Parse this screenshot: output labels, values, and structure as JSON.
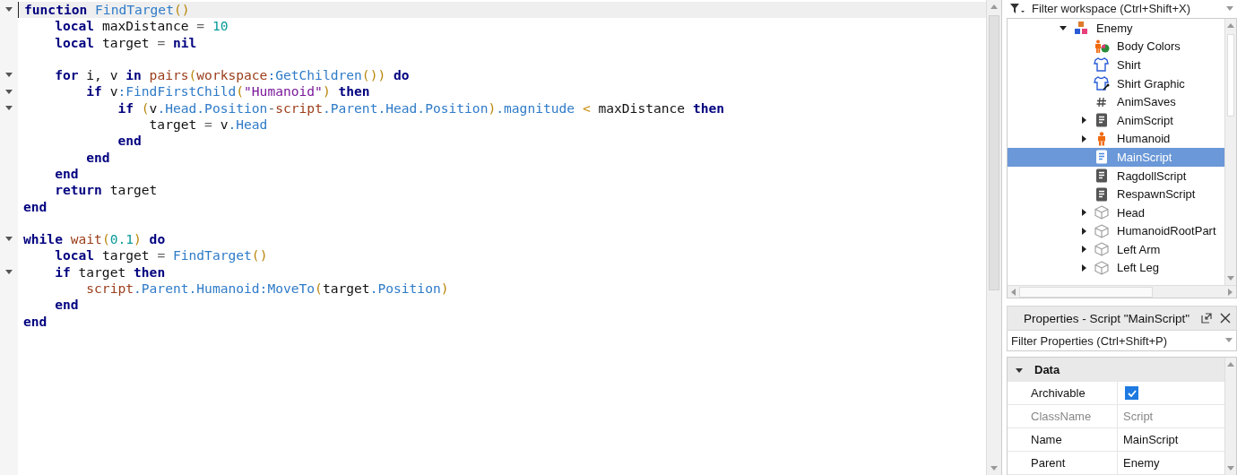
{
  "editor": {
    "lines": [
      {
        "foldable": true,
        "current": true,
        "tokens": [
          {
            "kind": "kw",
            "text": "function "
          },
          {
            "kind": "fn",
            "text": "FindTarget"
          },
          {
            "kind": "p",
            "text": "()"
          }
        ]
      },
      {
        "foldable": false,
        "current": false,
        "tokens": [
          {
            "kind": "kw",
            "text": "    local "
          },
          {
            "kind": "id",
            "text": "maxDistance "
          },
          {
            "kind": "op",
            "text": "= "
          },
          {
            "kind": "num",
            "text": "10"
          }
        ]
      },
      {
        "foldable": false,
        "current": false,
        "tokens": [
          {
            "kind": "kw",
            "text": "    local "
          },
          {
            "kind": "id",
            "text": "target "
          },
          {
            "kind": "op",
            "text": "= "
          },
          {
            "kind": "kw",
            "text": "nil"
          }
        ]
      },
      {
        "foldable": false,
        "current": false
      },
      {
        "foldable": true,
        "current": false,
        "tokens": [
          {
            "kind": "kw",
            "text": "    for "
          },
          {
            "kind": "id",
            "text": "i, v "
          },
          {
            "kind": "kw",
            "text": "in "
          },
          {
            "kind": "bi",
            "text": "pairs"
          },
          {
            "kind": "p",
            "text": "("
          },
          {
            "kind": "bi",
            "text": "workspace"
          },
          {
            "kind": "fn",
            "text": ":GetChildren"
          },
          {
            "kind": "p",
            "text": "())"
          },
          {
            "kind": "kw",
            "text": " do"
          }
        ]
      },
      {
        "foldable": true,
        "current": false,
        "tokens": [
          {
            "kind": "kw",
            "text": "        if "
          },
          {
            "kind": "id",
            "text": "v"
          },
          {
            "kind": "fn",
            "text": ":FindFirstChild"
          },
          {
            "kind": "p",
            "text": "("
          },
          {
            "kind": "str",
            "text": "\"Humanoid\""
          },
          {
            "kind": "p",
            "text": ") "
          },
          {
            "kind": "kw",
            "text": "then"
          }
        ]
      },
      {
        "foldable": true,
        "current": false,
        "tokens": [
          {
            "kind": "kw",
            "text": "            if "
          },
          {
            "kind": "p",
            "text": "("
          },
          {
            "kind": "id",
            "text": "v"
          },
          {
            "kind": "fn",
            "text": ".Head.Position"
          },
          {
            "kind": "op",
            "text": "-"
          },
          {
            "kind": "bi",
            "text": "script"
          },
          {
            "kind": "fn",
            "text": ".Parent.Head.Position"
          },
          {
            "kind": "p",
            "text": ")"
          },
          {
            "kind": "fn",
            "text": ".magnitude "
          },
          {
            "kind": "lt",
            "text": "< "
          },
          {
            "kind": "id",
            "text": "maxDistance "
          },
          {
            "kind": "kw",
            "text": "then"
          }
        ]
      },
      {
        "foldable": false,
        "current": false,
        "tokens": [
          {
            "kind": "id",
            "text": "                target "
          },
          {
            "kind": "op",
            "text": "= "
          },
          {
            "kind": "id",
            "text": "v"
          },
          {
            "kind": "fn",
            "text": ".Head"
          }
        ]
      },
      {
        "foldable": false,
        "current": false,
        "tokens": [
          {
            "kind": "kw",
            "text": "            end"
          }
        ]
      },
      {
        "foldable": false,
        "current": false,
        "tokens": [
          {
            "kind": "kw",
            "text": "        end"
          }
        ]
      },
      {
        "foldable": false,
        "current": false,
        "tokens": [
          {
            "kind": "kw",
            "text": "    end"
          }
        ]
      },
      {
        "foldable": false,
        "current": false,
        "tokens": [
          {
            "kind": "kw",
            "text": "    return "
          },
          {
            "kind": "id",
            "text": "target"
          }
        ]
      },
      {
        "foldable": false,
        "current": false,
        "tokens": [
          {
            "kind": "kw",
            "text": "end"
          }
        ]
      },
      {
        "foldable": false,
        "current": false
      },
      {
        "foldable": true,
        "current": false,
        "tokens": [
          {
            "kind": "kw",
            "text": "while "
          },
          {
            "kind": "bi",
            "text": "wait"
          },
          {
            "kind": "p",
            "text": "("
          },
          {
            "kind": "num",
            "text": "0.1"
          },
          {
            "kind": "p",
            "text": ") "
          },
          {
            "kind": "kw",
            "text": "do"
          }
        ]
      },
      {
        "foldable": false,
        "current": false,
        "tokens": [
          {
            "kind": "kw",
            "text": "    local "
          },
          {
            "kind": "id",
            "text": "target "
          },
          {
            "kind": "op",
            "text": "= "
          },
          {
            "kind": "fn",
            "text": "FindTarget"
          },
          {
            "kind": "p",
            "text": "()"
          }
        ]
      },
      {
        "foldable": true,
        "current": false,
        "tokens": [
          {
            "kind": "kw",
            "text": "    if "
          },
          {
            "kind": "id",
            "text": "target "
          },
          {
            "kind": "kw",
            "text": "then"
          }
        ]
      },
      {
        "foldable": false,
        "current": false,
        "tokens": [
          {
            "kind": "bi",
            "text": "        script"
          },
          {
            "kind": "fn",
            "text": ".Parent.Humanoid:MoveTo"
          },
          {
            "kind": "p",
            "text": "("
          },
          {
            "kind": "id",
            "text": "target"
          },
          {
            "kind": "fn",
            "text": ".Position"
          },
          {
            "kind": "p",
            "text": ")"
          }
        ]
      },
      {
        "foldable": false,
        "current": false,
        "tokens": [
          {
            "kind": "kw",
            "text": "    end"
          }
        ]
      },
      {
        "foldable": false,
        "current": false,
        "tokens": [
          {
            "kind": "kw",
            "text": "end"
          }
        ]
      }
    ]
  },
  "explorer": {
    "filter": {
      "placeholder": "Filter workspace (Ctrl+Shift+X)"
    },
    "items": [
      {
        "name": "Enemy",
        "kind": "model",
        "expandable": true,
        "expanded": true,
        "selected": false,
        "children": [
          {
            "name": "Body Colors",
            "kind": "body-colors",
            "expandable": false,
            "selected": false
          },
          {
            "name": "Shirt",
            "kind": "shirt",
            "expandable": false,
            "selected": false
          },
          {
            "name": "Shirt Graphic",
            "kind": "shirt-graphic",
            "expandable": false,
            "selected": false
          },
          {
            "name": "AnimSaves",
            "kind": "value",
            "expandable": false,
            "selected": false
          },
          {
            "name": "AnimScript",
            "kind": "script",
            "expandable": true,
            "expanded": false,
            "selected": false
          },
          {
            "name": "Humanoid",
            "kind": "humanoid",
            "expandable": true,
            "expanded": false,
            "selected": false
          },
          {
            "name": "MainScript",
            "kind": "script",
            "expandable": false,
            "selected": true
          },
          {
            "name": "RagdollScript",
            "kind": "script",
            "expandable": false,
            "selected": false
          },
          {
            "name": "RespawnScript",
            "kind": "script",
            "expandable": false,
            "selected": false
          },
          {
            "name": "Head",
            "kind": "part",
            "expandable": true,
            "expanded": false,
            "selected": false
          },
          {
            "name": "HumanoidRootPart",
            "kind": "part",
            "expandable": true,
            "expanded": false,
            "selected": false
          },
          {
            "name": "Left Arm",
            "kind": "part",
            "expandable": true,
            "expanded": false,
            "selected": false
          },
          {
            "name": "Left Leg",
            "kind": "part",
            "expandable": true,
            "expanded": false,
            "selected": false
          }
        ]
      }
    ]
  },
  "properties": {
    "title": "Properties - Script \"MainScript\"",
    "filter": {
      "placeholder": "Filter Properties (Ctrl+Shift+P)"
    },
    "category": {
      "name": "Data",
      "expanded": true
    },
    "rows": [
      {
        "name": "Archivable",
        "kind": "check",
        "checked": true,
        "readonly": false
      },
      {
        "name": "ClassName",
        "kind": "text",
        "value": "Script",
        "readonly": true
      },
      {
        "name": "Name",
        "kind": "text",
        "value": "MainScript",
        "readonly": false
      },
      {
        "name": "Parent",
        "kind": "text",
        "value": "Enemy",
        "readonly": false
      }
    ]
  }
}
